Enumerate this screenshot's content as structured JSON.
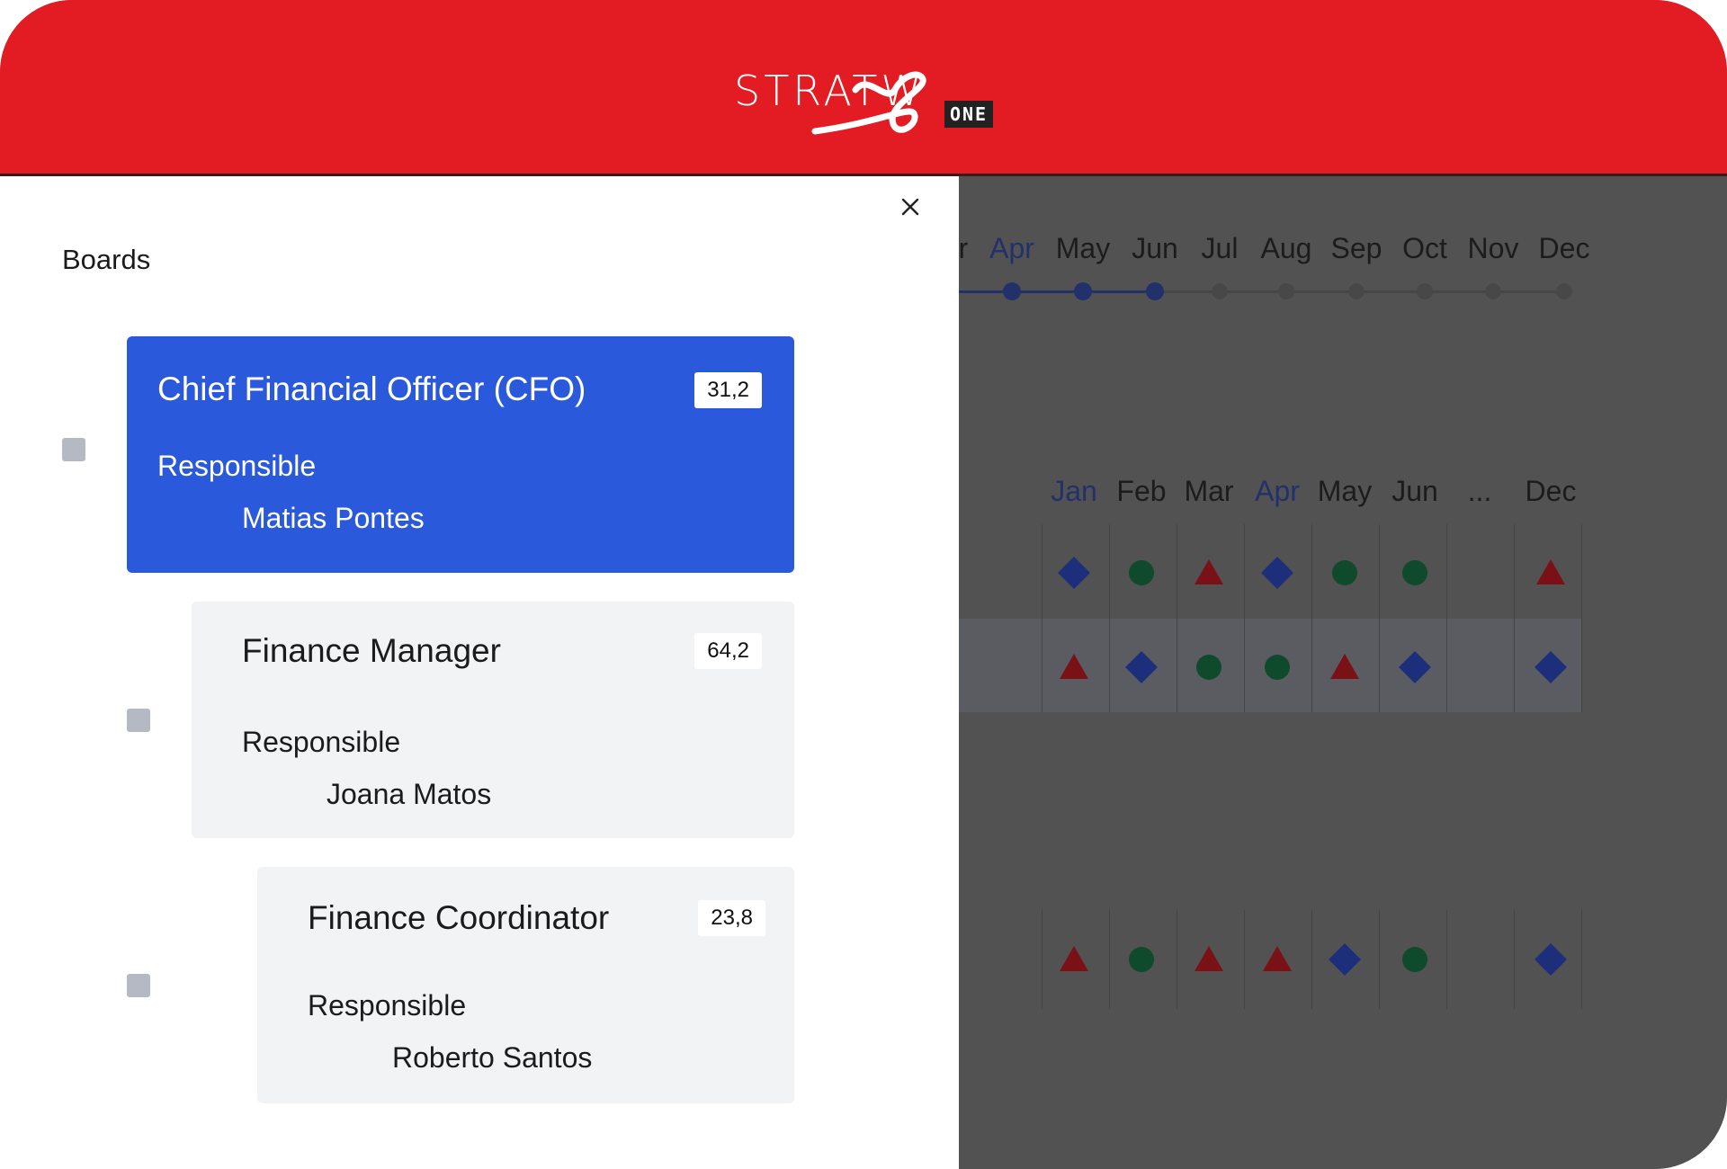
{
  "brand": {
    "name": "STRATWS",
    "word": "STRATW",
    "badge": "ONE",
    "header_color": "#e31b23"
  },
  "drawer": {
    "title": "Boards",
    "close_icon": "close-icon",
    "boards": [
      {
        "title": "Chief Financial Officer (CFO)",
        "score": "31,2",
        "responsible_label": "Responsible",
        "responsible": "Matias Pontes",
        "selected": true
      },
      {
        "title": "Finance Manager",
        "score": "64,2",
        "responsible_label": "Responsible",
        "responsible": "Joana Matos",
        "selected": false
      },
      {
        "title": "Finance Coordinator",
        "score": "23,8",
        "responsible_label": "Responsible",
        "responsible": "Roberto Santos",
        "selected": false
      }
    ]
  },
  "timeline": {
    "partial_month": "r",
    "months": [
      "Apr",
      "May",
      "Jun",
      "Jul",
      "Aug",
      "Sep",
      "Oct",
      "Nov",
      "Dec"
    ],
    "active_months": [
      "Apr"
    ],
    "completed_count": 3
  },
  "grid": {
    "months": [
      "Jan",
      "Feb",
      "Mar",
      "Apr",
      "May",
      "Jun",
      "...",
      "Dec"
    ],
    "active_months": [
      "Jan",
      "Apr"
    ],
    "rows": [
      [
        "diamond",
        "circle",
        "triangle",
        "diamond",
        "circle",
        "circle",
        "",
        "triangle"
      ],
      [
        "triangle",
        "diamond",
        "circle",
        "circle",
        "triangle",
        "diamond",
        "",
        "diamond"
      ],
      [
        "triangle",
        "circle",
        "triangle",
        "triangle",
        "diamond",
        "circle",
        "",
        "diamond"
      ]
    ],
    "shape_colors": {
      "diamond": "#1d2f7a",
      "circle": "#0f4a2c",
      "triangle": "#7a1116"
    }
  }
}
